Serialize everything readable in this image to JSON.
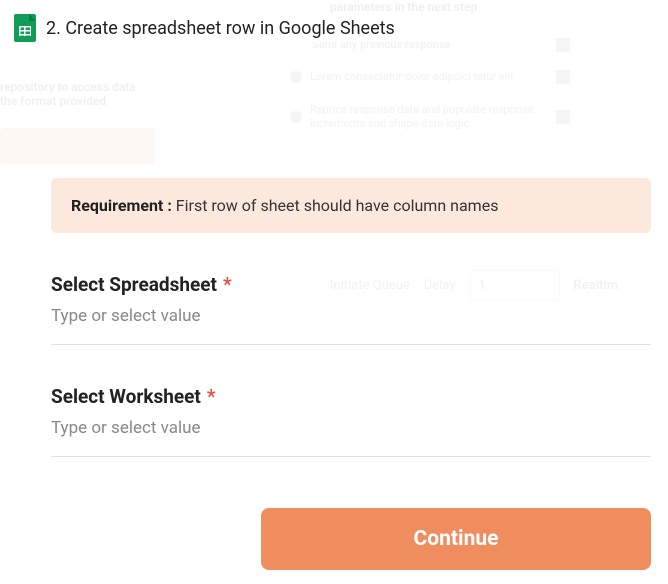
{
  "header": {
    "step_number": "2.",
    "title": "Create spreadsheet row in Google Sheets"
  },
  "requirement": {
    "label": "Requirement :",
    "text": "First row of sheet should have column names"
  },
  "fields": {
    "spreadsheet": {
      "label": "Select Spreadsheet",
      "placeholder": "Type or select value"
    },
    "worksheet": {
      "label": "Select Worksheet",
      "placeholder": "Type or select value"
    }
  },
  "continue_button": "Continue",
  "background": {
    "left_line1": "repository to access data",
    "left_line2": "the format provided",
    "right_top": "parameters in the next step",
    "right_line1": "Send any previous response",
    "right_line2": "Lorem consectetur dolor adipsici tetur elit",
    "right_line3": "Reprice response data and populate response incrementa and shape data logic",
    "bottom_label1": "Initiate Queue",
    "bottom_label2": "Delay",
    "bottom_value": "1",
    "bottom_label3": "Realtim"
  }
}
